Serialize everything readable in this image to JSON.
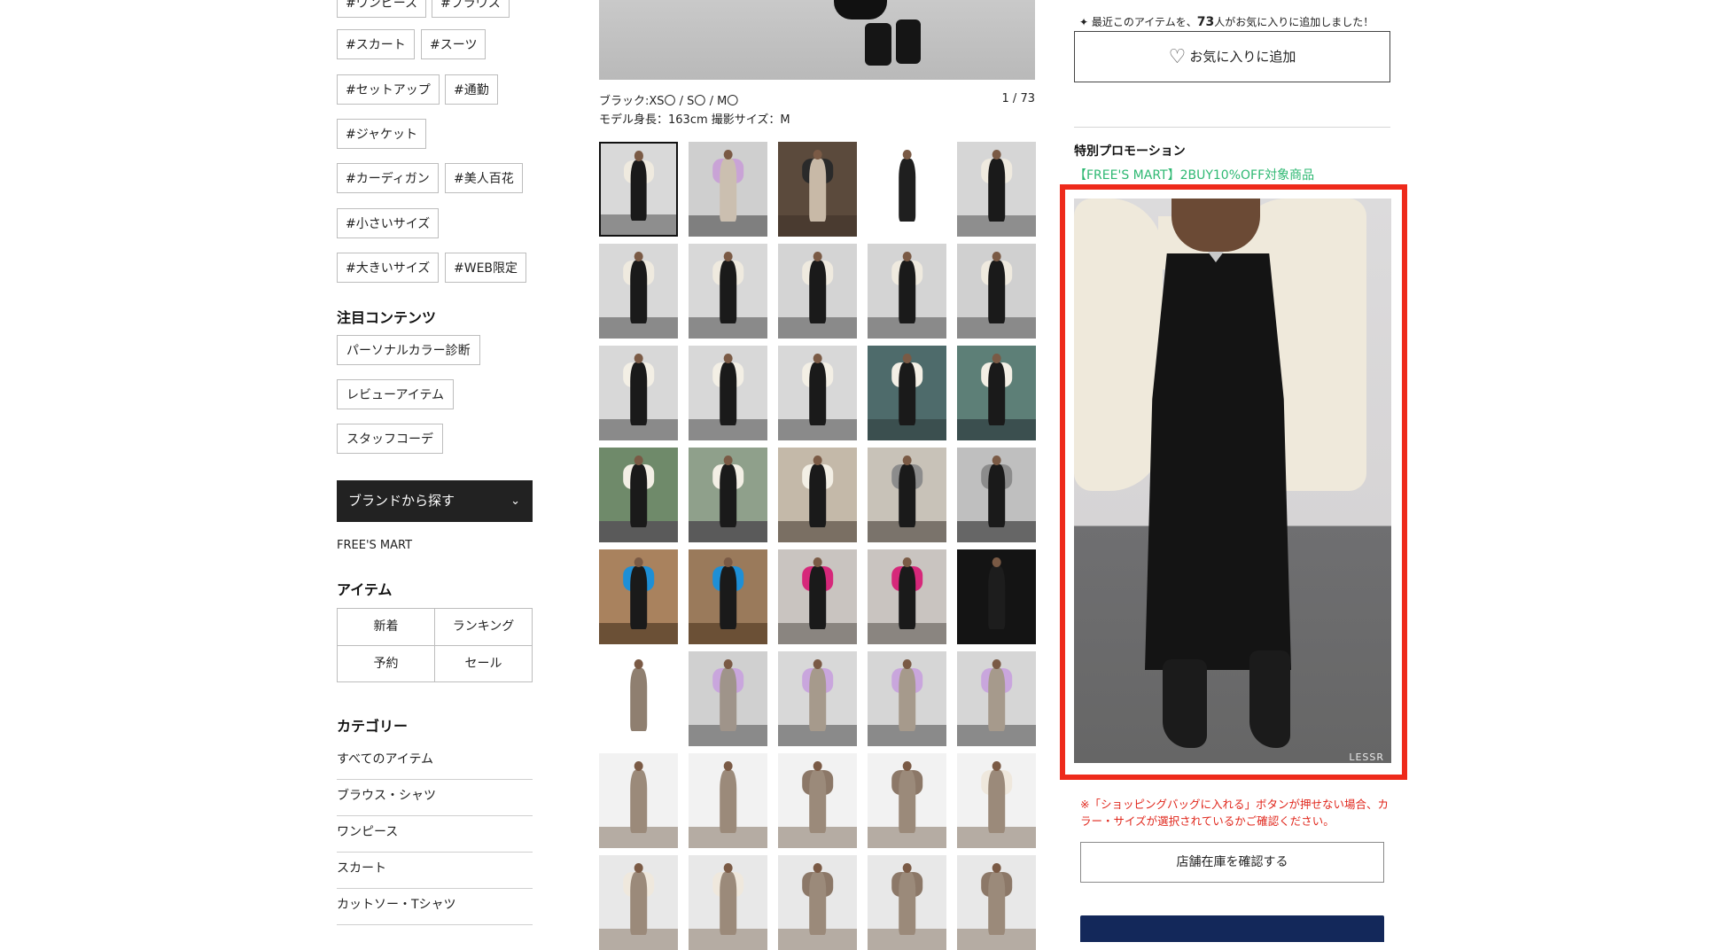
{
  "sidebar": {
    "tags": [
      "#ワンピース",
      "#ブラウス",
      "#スカート",
      "#スーツ",
      "#セットアップ",
      "#通勤",
      "#ジャケット",
      "#カーディガン",
      "#美人百花",
      "#小さいサイズ",
      "#大きいサイズ",
      "#WEB限定"
    ],
    "featured_title": "注目コンテンツ",
    "featured_links": [
      "パーソナルカラー診断",
      "レビューアイテム",
      "スタッフコーデ"
    ],
    "brand_button_label": "ブランドから探す",
    "brand_name": "FREE'S MART",
    "item_title": "アイテム",
    "item_links": [
      "新着",
      "ランキング",
      "予約",
      "セール"
    ],
    "category_title": "カテゴリー",
    "categories": [
      "すべてのアイテム",
      "ブラウス・シャツ",
      "ワンピース",
      "スカート",
      "カットソー・Tシャツ"
    ]
  },
  "product": {
    "color_size": "ブラック:XS〇 / S〇 / M〇",
    "model_info": "モデル身長：163cm 撮影サイズ：M",
    "image_counter": "1 / 73"
  },
  "thumbnails": [
    {
      "bg": "#d9d9d9",
      "body": "#1a1a1a",
      "arms": "#efeadf",
      "floor": "#8e8e8e"
    },
    {
      "bg": "#cfcfcf",
      "body": "#cbbfb0",
      "arms": "#c9a3d6",
      "floor": "#7f7f7f"
    },
    {
      "bg": "#5b4a3c",
      "body": "#c8b9a7",
      "arms": "#2a2a2a",
      "floor": "#4a3b30"
    },
    {
      "bg": "#ffffff",
      "body": "#1f1f1f",
      "arms": "#ffffff",
      "floor": "#ffffff"
    },
    {
      "bg": "#d6d6d6",
      "body": "#1a1a1a",
      "arms": "#efeadf",
      "floor": "#8e8e8e"
    },
    {
      "bg": "#d8d8d8",
      "body": "#1a1a1a",
      "arms": "#efeadf",
      "floor": "#8a8a8a"
    },
    {
      "bg": "#d8d8d8",
      "body": "#1a1a1a",
      "arms": "#efeadf",
      "floor": "#8a8a8a"
    },
    {
      "bg": "#d4d4d4",
      "body": "#1a1a1a",
      "arms": "#efeadf",
      "floor": "#8a8a8a"
    },
    {
      "bg": "#d4d4d4",
      "body": "#1a1a1a",
      "arms": "#efeadf",
      "floor": "#8a8a8a"
    },
    {
      "bg": "#d0d0d0",
      "body": "#1a1a1a",
      "arms": "#efeadf",
      "floor": "#8a8a8a"
    },
    {
      "bg": "#d8d8d8",
      "body": "#1a1a1a",
      "arms": "#f3efe5",
      "floor": "#8a8a8a"
    },
    {
      "bg": "#d8d8d8",
      "body": "#1a1a1a",
      "arms": "#f3efe5",
      "floor": "#8a8a8a"
    },
    {
      "bg": "#d8d8d8",
      "body": "#1a1a1a",
      "arms": "#f3efe5",
      "floor": "#8a8a8a"
    },
    {
      "bg": "#4e6b6b",
      "body": "#1a1a1a",
      "arms": "#f3efe5",
      "floor": "#3b4f4f"
    },
    {
      "bg": "#5d7f77",
      "body": "#1a1a1a",
      "arms": "#f3efe5",
      "floor": "#3b4f4f"
    },
    {
      "bg": "#6f8a6a",
      "body": "#1a1a1a",
      "arms": "#f3efe5",
      "floor": "#5a5a5a"
    },
    {
      "bg": "#8fa08b",
      "body": "#1a1a1a",
      "arms": "#f3efe5",
      "floor": "#5a5a5a"
    },
    {
      "bg": "#c4b9a9",
      "body": "#1a1a1a",
      "arms": "#f3efe5",
      "floor": "#7a6f63"
    },
    {
      "bg": "#c8c2b8",
      "body": "#1a1a1a",
      "arms": "#8c8c8c",
      "floor": "#7a736b"
    },
    {
      "bg": "#bfbfbf",
      "body": "#1a1a1a",
      "arms": "#8c8c8c",
      "floor": "#666666"
    },
    {
      "bg": "#a9825e",
      "body": "#1a1a1a",
      "arms": "#1e8fd6",
      "floor": "#6b5036"
    },
    {
      "bg": "#9a7a5b",
      "body": "#1a1a1a",
      "arms": "#1e8fd6",
      "floor": "#6b5036"
    },
    {
      "bg": "#c9c4c0",
      "body": "#1a1a1a",
      "arms": "#d6287a",
      "floor": "#8a8580"
    },
    {
      "bg": "#c9c4c0",
      "body": "#1a1a1a",
      "arms": "#d6287a",
      "floor": "#8a8580"
    },
    {
      "bg": "#141414",
      "body": "#1d1d1d",
      "arms": "#141414",
      "floor": "#141414"
    },
    {
      "bg": "#ffffff",
      "body": "#8f7f70",
      "arms": "#ffffff",
      "floor": "#ffffff"
    },
    {
      "bg": "#d0d0d0",
      "body": "#9f948a",
      "arms": "#c9a6dd",
      "floor": "#8a8a8a"
    },
    {
      "bg": "#d8d8d8",
      "body": "#a69a8c",
      "arms": "#c9a6dd",
      "floor": "#8a8a8a"
    },
    {
      "bg": "#d6d6d6",
      "body": "#a69a8c",
      "arms": "#c9a6dd",
      "floor": "#8a8a8a"
    },
    {
      "bg": "#d6d6d6",
      "body": "#a69a8c",
      "arms": "#c9a6dd",
      "floor": "#8a8a8a"
    },
    {
      "bg": "#f2f2f2",
      "body": "#9b8a7a",
      "arms": "#f2f2f2",
      "floor": "#b5aca3"
    },
    {
      "bg": "#f2f2f2",
      "body": "#9b8a7a",
      "arms": "#f2f2f2",
      "floor": "#b5aca3"
    },
    {
      "bg": "#f2f2f2",
      "body": "#9b8a7a",
      "arms": "#8c7868",
      "floor": "#b5aca3"
    },
    {
      "bg": "#f2f2f2",
      "body": "#9b8a7a",
      "arms": "#8c7868",
      "floor": "#b5aca3"
    },
    {
      "bg": "#f2f2f2",
      "body": "#9b8a7a",
      "arms": "#efe8dd",
      "floor": "#b5aca3"
    },
    {
      "bg": "#e8e8e8",
      "body": "#9b8a7a",
      "arms": "#efe8dd",
      "floor": "#b5aca3"
    },
    {
      "bg": "#e8e8e8",
      "body": "#9b8a7a",
      "arms": "#efe8dd",
      "floor": "#b5aca3"
    },
    {
      "bg": "#e8e8e8",
      "body": "#9b8a7a",
      "arms": "#8c7868",
      "floor": "#b5aca3"
    },
    {
      "bg": "#e8e8e8",
      "body": "#9b8a7a",
      "arms": "#8c7868",
      "floor": "#b5aca3"
    },
    {
      "bg": "#e8e8e8",
      "body": "#9b8a7a",
      "arms": "#8c7868",
      "floor": "#b5aca3"
    }
  ],
  "right": {
    "favorite_notice_prefix": "最近このアイテムを、",
    "favorite_count": "73",
    "favorite_notice_suffix": "人がお気に入りに追加しました！",
    "favorite_button_label": "お気に入りに追加",
    "promo_title": "特別プロモーション",
    "promo_link": "【FREE'S MART】2BUY10%OFF対象商品",
    "watermark": "LESSR",
    "warning": "※「ショッピングバッグに入れる」ボタンが押せない場合、カラー・サイズが選択されているかご確認ください。",
    "stock_button_label": "店舗在庫を確認する"
  },
  "colors": {
    "highlight_frame": "#ee2a1b",
    "promo_green": "#2eb872",
    "warning_red": "#e0261b",
    "cart_navy": "#13285a"
  }
}
